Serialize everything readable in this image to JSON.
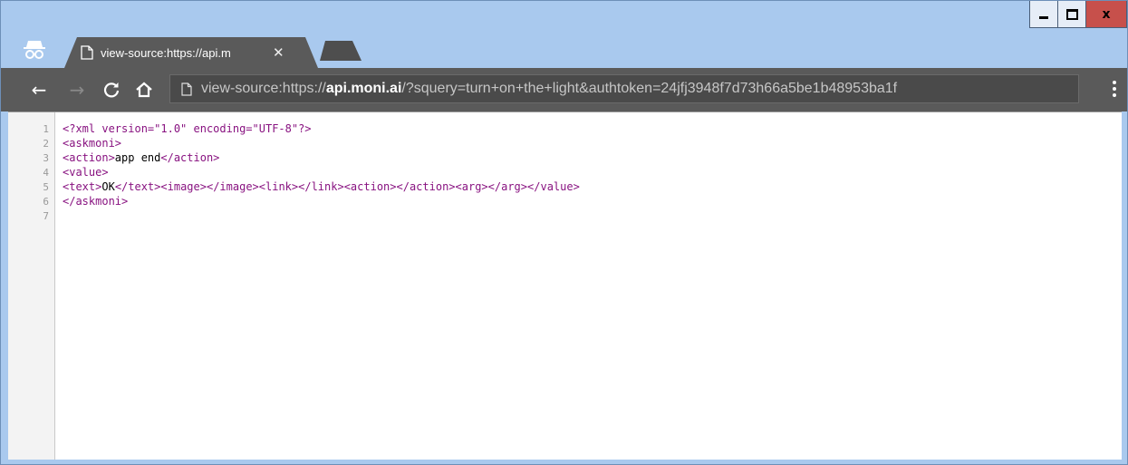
{
  "tab": {
    "title": "view-source:https://api.m",
    "close": "✕"
  },
  "window": {
    "close": "x"
  },
  "address": {
    "prefix": "view-source:https://",
    "host": "api.moni.ai",
    "rest": "/?squery=turn+on+the+light&authtoken=24jfj3948f7d73h66a5be1b48953ba1f"
  },
  "source": {
    "lines": [
      {
        "no": "1",
        "text": "<?xml version=\"1.0\" encoding=\"UTF-8\"?>"
      },
      {
        "no": "2",
        "text": "<askmoni>"
      },
      {
        "no": "3",
        "text": "<action>app end</action>"
      },
      {
        "no": "4",
        "text": "<value>"
      },
      {
        "no": "5",
        "text": "<text>OK</text><image></image><link></link><action></action><arg></arg></value>"
      },
      {
        "no": "6",
        "text": "</askmoni>"
      },
      {
        "no": "7",
        "text": ""
      }
    ]
  },
  "icons": [
    "incognito-icon",
    "page-icon",
    "back-icon",
    "forward-icon",
    "reload-icon",
    "home-icon",
    "menu-icon",
    "minimize-icon",
    "maximize-icon",
    "close-icon"
  ],
  "colors": {
    "frame": "#a9c9ee",
    "toolbar": "#5a5a5a",
    "tag": "#881280",
    "close": "#c7504b"
  }
}
